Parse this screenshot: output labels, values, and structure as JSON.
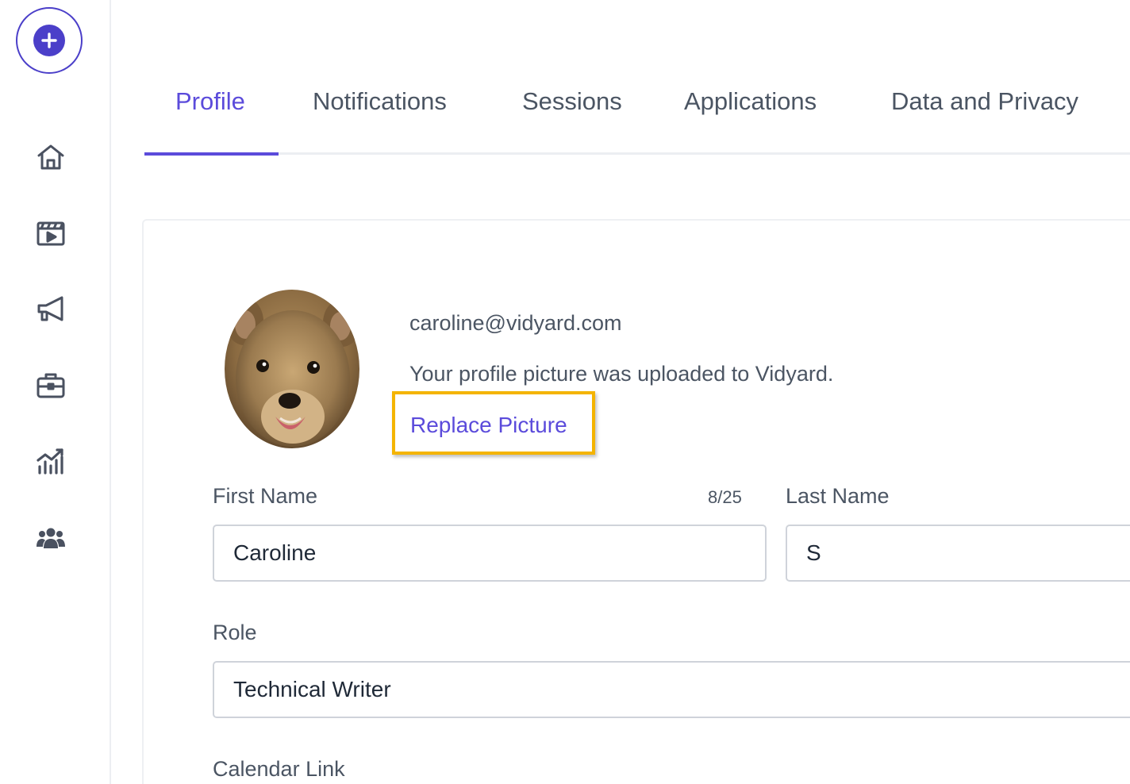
{
  "colors": {
    "accent": "#5b4bdb",
    "highlight": "#f4b400"
  },
  "sidebar": {
    "create_icon": "plus-icon",
    "items": [
      {
        "id": "home",
        "icon": "home-icon"
      },
      {
        "id": "videos",
        "icon": "video-library-icon"
      },
      {
        "id": "campaigns",
        "icon": "megaphone-icon"
      },
      {
        "id": "tools",
        "icon": "briefcase-icon"
      },
      {
        "id": "analytics",
        "icon": "analytics-icon"
      },
      {
        "id": "team",
        "icon": "team-icon"
      }
    ]
  },
  "tabs": [
    {
      "label": "Profile",
      "active": true
    },
    {
      "label": "Notifications",
      "active": false
    },
    {
      "label": "Sessions",
      "active": false
    },
    {
      "label": "Applications",
      "active": false
    },
    {
      "label": "Data and Privacy",
      "active": false
    }
  ],
  "profile": {
    "email": "caroline@vidyard.com",
    "upload_message": "Your profile picture was uploaded to Vidyard.",
    "replace_label": "Replace Picture",
    "first_name_label": "First Name",
    "first_name_counter": "8/25",
    "first_name_value": "Caroline",
    "last_name_label": "Last Name",
    "last_name_value": "S",
    "role_label": "Role",
    "role_value": "Technical Writer",
    "calendar_label": "Calendar Link"
  }
}
